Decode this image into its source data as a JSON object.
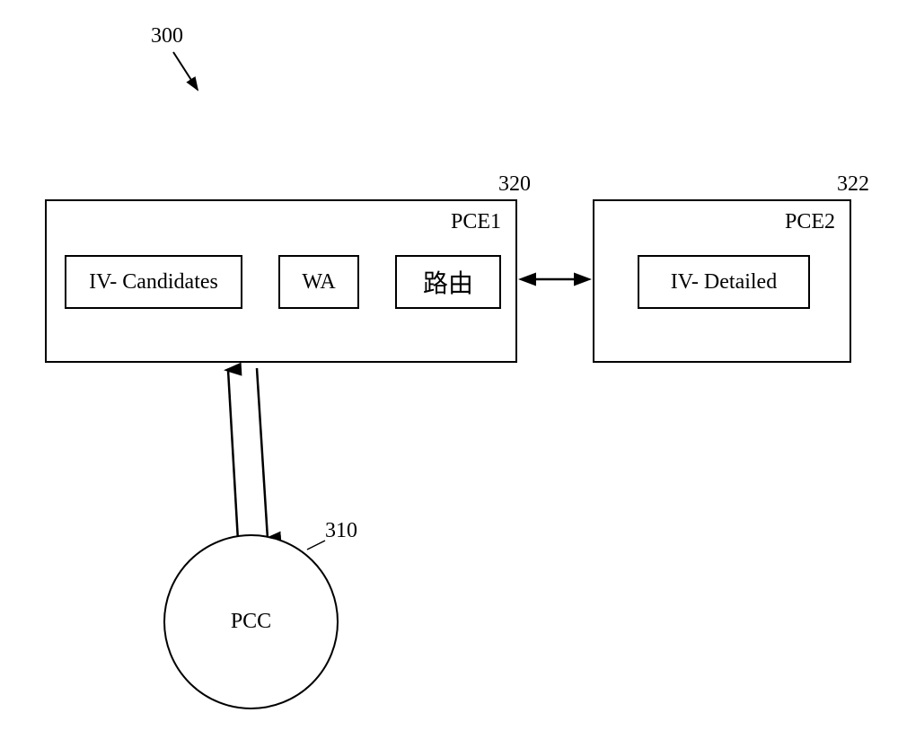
{
  "figure_label": "300",
  "pce1": {
    "ref": "320",
    "title": "PCE1",
    "items": {
      "iv_candidates": "IV- Candidates",
      "wa": "WA",
      "routing": "路由"
    }
  },
  "pce2": {
    "ref": "322",
    "title": "PCE2",
    "items": {
      "iv_detailed": "IV- Detailed"
    }
  },
  "pcc": {
    "ref": "310",
    "label": "PCC"
  }
}
